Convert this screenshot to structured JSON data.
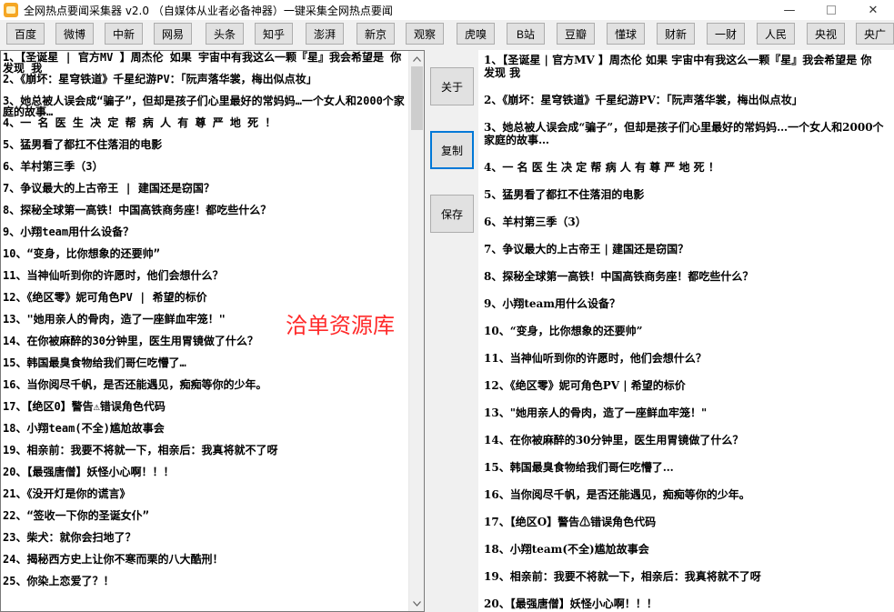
{
  "window": {
    "title": "全网热点要闻采集器 v2.0  （自媒体从业者必备神器）一键采集全网热点要闻",
    "minimize_glyph": "—",
    "close_glyph": "✕"
  },
  "toolbar": {
    "buttons": [
      "百度",
      "微博",
      "中新",
      "网易",
      "头条",
      "知乎",
      "澎湃",
      "新京",
      "观察",
      "虎嗅",
      "B站",
      "豆瓣",
      "懂球",
      "财新",
      "一财",
      "人民",
      "央视",
      "央广"
    ]
  },
  "side_buttons": {
    "about": "关于",
    "copy": "复制",
    "save": "保存"
  },
  "watermark": "洽单资源库",
  "left_list": [
    "1、【圣诞星 | 官方MV 】周杰伦 如果 宇宙中有我这么一颗『星』我会希望是 你 发现 我",
    "2、《崩坏：星穹铁道》千星纪游PV：「阮声落华裳，梅出似点妆」",
    "3、她总被人误会成“骗子”，但却是孩子们心里最好的常妈妈…一个女人和2000个家庭的故事…",
    "4、一 名 医 生 决 定 帮 病 人 有 尊 严 地 死 ！",
    "5、猛男看了都扛不住落泪的电影",
    "6、羊村第三季（3）",
    "7、争议最大的上古帝王 | 建国还是窃国？",
    "8、探秘全球第一高铁！中国高铁商务座！都吃些什么？",
    "9、小翔team用什么设备？",
    "10、“变身，比你想象的还要帅”",
    "11、当神仙听到你的许愿时，他们会想什么？",
    "12、《绝区零》妮可角色PV | 希望的标价",
    "13、\"她用亲人的骨肉，造了一座鲜血牢笼！\"",
    "14、在你被麻醉的30分钟里，医生用胃镜做了什么？",
    "15、韩国最臭食物给我们哥仨吃懵了…",
    "16、当你阅尽千帆，是否还能遇见，痴痴等你的少年。",
    "17、【绝区0】警告⚠错误角色代码",
    "18、小翔team(不全)尴尬故事会",
    "19、相亲前：我要不将就一下，相亲后：我真将就不了呀",
    "20、【最强唐僧】妖怪小心啊！！！",
    "21、《没开灯是你的谎言》",
    "22、“签收一下你的圣诞女仆”",
    "23、柴犬：就你会扫地了？",
    "24、揭秘西方史上让你不寒而栗的八大酷刑！",
    "25、你染上恋爱了？！"
  ],
  "right_list": [
    "1、【圣诞星 | 官方MV 】周杰伦 如果 宇宙中有我这么一颗『星』我会希望是 你 发现 我",
    "2、《崩坏：星穹铁道》千星纪游PV：「阮声落华裳，梅出似点妆」",
    "3、她总被人误会成“骗子”，但却是孩子们心里最好的常妈妈…一个女人和2000个家庭的故事…",
    "4、一 名 医 生 决 定 帮 病 人 有 尊 严 地 死 ！",
    "5、猛男看了都扛不住落泪的电影",
    "6、羊村第三季（3）",
    "7、争议最大的上古帝王 | 建国还是窃国？",
    "8、探秘全球第一高铁！中国高铁商务座！都吃些什么？",
    "9、小翔team用什么设备？",
    "10、“变身，比你想象的还要帅”",
    "11、当神仙听到你的许愿时，他们会想什么？",
    "12、《绝区零》妮可角色PV | 希望的标价",
    "13、\"她用亲人的骨肉，造了一座鲜血牢笼！\"",
    "14、在你被麻醉的30分钟里，医生用胃镜做了什么？",
    "15、韩国最臭食物给我们哥仨吃懵了…",
    "16、当你阅尽千帆，是否还能遇见，痴痴等你的少年。",
    "17、【绝区O】警告⚠错误角色代码",
    "18、小翔team(不全)尴尬故事会",
    "19、相亲前：我要不将就一下，相亲后：我真将就不了呀",
    "20、【最强唐僧】妖怪小心啊！！！"
  ]
}
